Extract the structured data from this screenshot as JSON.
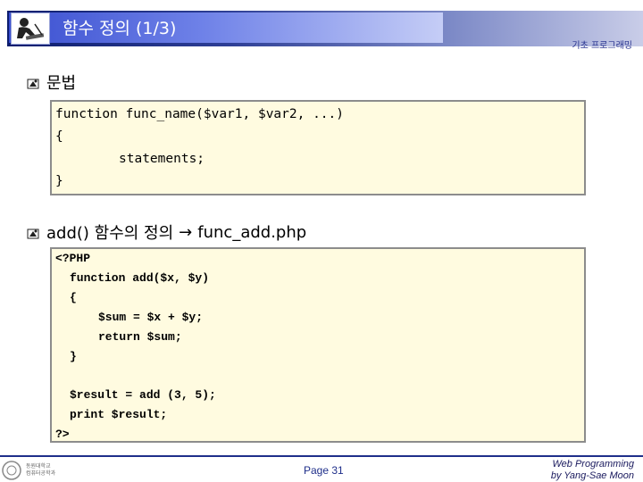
{
  "header": {
    "title": "함수 정의 (1/3)",
    "subtitle": "기초 프로그래밍"
  },
  "bullets": [
    {
      "text": "문법"
    },
    {
      "text_prefix": "add() 함수의 정의",
      "arrow": "→",
      "text_suffix": "func_add.php"
    }
  ],
  "syntax_box": {
    "lines": [
      "function func_name($var1, $var2, ...)",
      "{",
      "statements;",
      "}"
    ]
  },
  "example_box": {
    "lines": [
      "<?PHP",
      "function add($x, $y)",
      "{",
      "$sum = $x + $y;",
      "return $sum;",
      "}",
      "$result = add (3, 5);",
      "print $result;",
      "?>"
    ]
  },
  "footer": {
    "logo_line1": "동원대학교",
    "logo_line2": "컴퓨터공학과",
    "page": "Page 31",
    "credit_line1": "Web Programming",
    "credit_line2": "by Yang-Sae Moon"
  },
  "colors": {
    "header_dark": "#0d1d6e",
    "code_bg": "#fffbe0",
    "accent": "#1f2f8a"
  }
}
